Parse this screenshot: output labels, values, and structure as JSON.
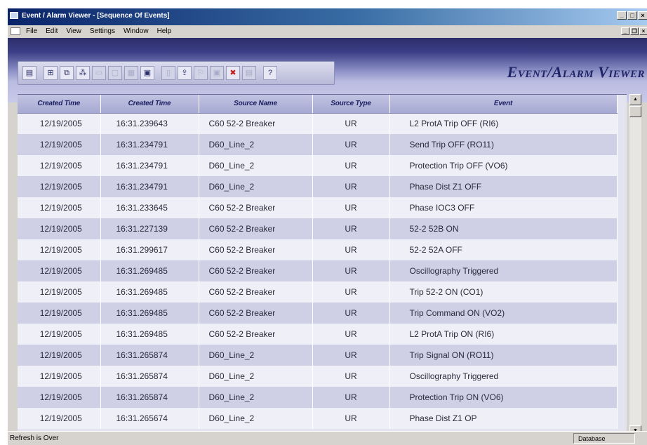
{
  "window": {
    "title": "Event / Alarm Viewer - [Sequence Of Events]"
  },
  "menu": [
    "File",
    "Edit",
    "View",
    "Settings",
    "Window",
    "Help"
  ],
  "banner": {
    "brand": "Event/Alarm Viewer"
  },
  "toolbar": [
    {
      "name": "list-icon",
      "glyph": "▤",
      "state": "normal"
    },
    {
      "name": "filter-table-icon",
      "glyph": "⊞",
      "state": "normal"
    },
    {
      "name": "tree-icon",
      "glyph": "⧉",
      "state": "normal"
    },
    {
      "name": "network-icon",
      "glyph": "⁂",
      "state": "normal"
    },
    {
      "name": "chart-icon",
      "glyph": "▭",
      "state": "dim"
    },
    {
      "name": "blank-icon",
      "glyph": "▢",
      "state": "dim"
    },
    {
      "name": "grid-icon",
      "glyph": "▦",
      "state": "dim"
    },
    {
      "name": "monitor-icon",
      "glyph": "▣",
      "state": "normal"
    },
    {
      "name": "page-icon",
      "glyph": "▯",
      "state": "dim"
    },
    {
      "name": "export-icon",
      "glyph": "⇪",
      "state": "normal"
    },
    {
      "name": "flag-icon",
      "glyph": "⚐",
      "state": "dim"
    },
    {
      "name": "clear-icon",
      "glyph": "▣",
      "state": "dim"
    },
    {
      "name": "delete-icon",
      "glyph": "✖",
      "state": "red"
    },
    {
      "name": "report-icon",
      "glyph": "▤",
      "state": "dim"
    },
    {
      "name": "help-icon",
      "glyph": "?",
      "state": "normal"
    }
  ],
  "table": {
    "headers": [
      "Created Time",
      "Created Time",
      "Source Name",
      "Source Type",
      "Event"
    ],
    "rows": [
      [
        "12/19/2005",
        "16:31.239643",
        "C60 52-2 Breaker",
        "UR",
        "L2 ProtA Trip OFF (RI6)"
      ],
      [
        "12/19/2005",
        "16:31.234791",
        "D60_Line_2",
        "UR",
        "Send Trip OFF (RO11)"
      ],
      [
        "12/19/2005",
        "16:31.234791",
        "D60_Line_2",
        "UR",
        "Protection Trip OFF (VO6)"
      ],
      [
        "12/19/2005",
        "16:31.234791",
        "D60_Line_2",
        "UR",
        "Phase Dist Z1 OFF"
      ],
      [
        "12/19/2005",
        "16:31.233645",
        "C60 52-2 Breaker",
        "UR",
        "Phase IOC3 OFF"
      ],
      [
        "12/19/2005",
        "16:31.227139",
        "C60 52-2 Breaker",
        "UR",
        "52-2 52B ON"
      ],
      [
        "12/19/2005",
        "16:31.299617",
        "C60 52-2 Breaker",
        "UR",
        "52-2 52A OFF"
      ],
      [
        "12/19/2005",
        "16:31.269485",
        "C60 52-2 Breaker",
        "UR",
        "Oscillography Triggered"
      ],
      [
        "12/19/2005",
        "16:31.269485",
        "C60 52-2 Breaker",
        "UR",
        "Trip 52-2 ON (CO1)"
      ],
      [
        "12/19/2005",
        "16:31.269485",
        "C60 52-2 Breaker",
        "UR",
        "Trip Command ON (VO2)"
      ],
      [
        "12/19/2005",
        "16:31.269485",
        "C60 52-2 Breaker",
        "UR",
        "L2 ProtA Trip ON (RI6)"
      ],
      [
        "12/19/2005",
        "16:31.265874",
        "D60_Line_2",
        "UR",
        "Trip Signal ON (RO11)"
      ],
      [
        "12/19/2005",
        "16:31.265874",
        "D60_Line_2",
        "UR",
        "Oscillography Triggered"
      ],
      [
        "12/19/2005",
        "16:31.265874",
        "D60_Line_2",
        "UR",
        "Protection Trip ON (VO6)"
      ],
      [
        "12/19/2005",
        "16:31.265674",
        "D60_Line_2",
        "UR",
        "Phase Dist Z1 OP"
      ]
    ]
  },
  "status": {
    "message": "Refresh is Over",
    "panel": "Database"
  }
}
